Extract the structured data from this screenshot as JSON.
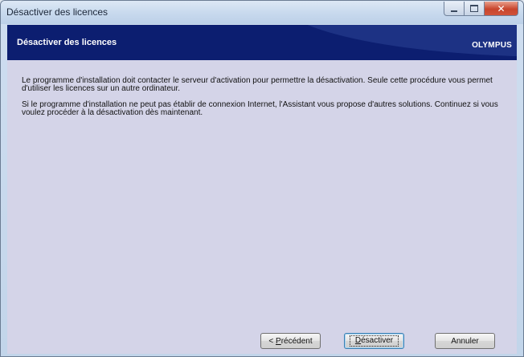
{
  "window": {
    "title": "Désactiver des licences",
    "controls": {
      "minimize": "minimize",
      "maximize": "maximize",
      "close": "✕"
    }
  },
  "header": {
    "title": "Désactiver des licences",
    "logo": "OLYMPUS"
  },
  "content": {
    "paragraph1": "Le programme d'installation doit contacter le serveur d'activation pour permettre la désactivation. Seule cette procédure vous permet d'utiliser les licences sur un autre ordinateur.",
    "paragraph2": "Si le programme d'installation ne peut pas établir de connexion Internet, l'Assistant vous propose d'autres solutions. Continuez si vous voulez procéder à la désactivation dès maintenant."
  },
  "buttons": {
    "previous": {
      "prefix": "< ",
      "mnemonic": "P",
      "rest": "récédent"
    },
    "deactivate": {
      "mnemonic": "D",
      "rest": "ésactiver"
    },
    "cancel": {
      "label": "Annuler"
    }
  },
  "colors": {
    "header_bg": "#0c1e70",
    "content_bg": "#d4d4e8",
    "close_button": "#c8452c"
  }
}
